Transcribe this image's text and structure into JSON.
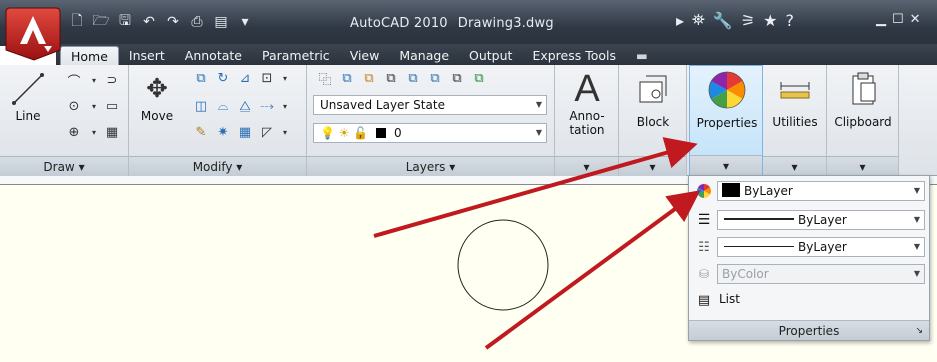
{
  "title": {
    "app": "AutoCAD 2010",
    "document": "Drawing3.dwg"
  },
  "tabs": [
    "Home",
    "Insert",
    "Annotate",
    "Parametric",
    "View",
    "Manage",
    "Output",
    "Express Tools"
  ],
  "ribbon": {
    "draw": {
      "line_label": "Line",
      "panel_label": "Draw ▾"
    },
    "modify": {
      "move_label": "Move",
      "panel_label": "Modify ▾"
    },
    "layers": {
      "state_value": "Unsaved Layer State",
      "layer_value": "0",
      "panel_label": "Layers ▾"
    },
    "annotation": {
      "label": "Anno-\ntation"
    },
    "block": {
      "label": "Block"
    },
    "properties": {
      "label": "Properties"
    },
    "utilities": {
      "label": "Utilities"
    },
    "clipboard": {
      "label": "Clipboard"
    },
    "panel_arrow": "▾"
  },
  "properties_panel": {
    "color_value": "ByLayer",
    "linetype_value": "ByLayer",
    "lineweight_value": "ByLayer",
    "plotstyle_value": "ByColor",
    "list_label": "List",
    "panel_label": "Properties",
    "corner_glyph": "↘"
  },
  "colors": {
    "accent_red": "#b01c1c",
    "arrow_red": "#c0191f",
    "canvas": "#fffff2"
  }
}
